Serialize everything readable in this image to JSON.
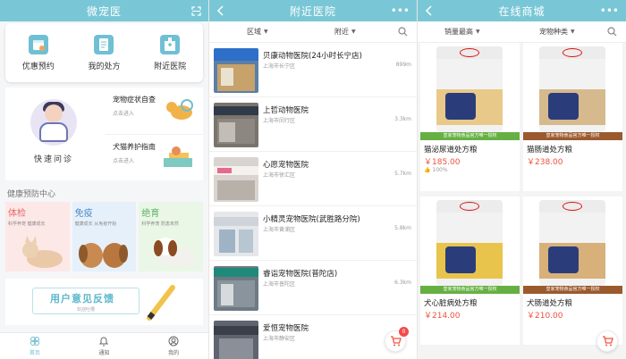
{
  "panel1": {
    "title": "微宠医",
    "quick": [
      {
        "icon": "calendar-icon",
        "label": "优惠预约"
      },
      {
        "icon": "prescription-icon",
        "label": "我的处方"
      },
      {
        "icon": "hospital-icon",
        "label": "附近医院"
      }
    ],
    "consult": {
      "label": "快速问诊",
      "items": [
        {
          "title": "宠物症状自查",
          "sub": "点击进入"
        },
        {
          "title": "犬猫养护指南",
          "sub": "点击进入"
        }
      ]
    },
    "section_title": "健康预防中心",
    "tiles": [
      {
        "title": "体检",
        "sub": "科学养宠   健康成长"
      },
      {
        "title": "免疫",
        "sub": "健康成长   从免疫开始"
      },
      {
        "title": "绝育",
        "sub": "科学养宠   防患未然"
      }
    ],
    "banner": {
      "text": "用户意见反馈",
      "sub": "欢迎吐槽"
    },
    "tabs": [
      {
        "icon": "home-icon",
        "label": "首页",
        "active": true
      },
      {
        "icon": "bell-icon",
        "label": "通知",
        "active": false
      },
      {
        "icon": "user-icon",
        "label": "我的",
        "active": false
      }
    ]
  },
  "panel2": {
    "title": "附近医院",
    "filters": [
      "区域",
      "附近"
    ],
    "clinics": [
      {
        "name": "贝康动物医院(24小时长宁店)",
        "addr": "上海市长宁区",
        "dist": "899m"
      },
      {
        "name": "上哲动物医院",
        "addr": "上海市闵行区",
        "dist": "3.3km"
      },
      {
        "name": "心愿宠物医院",
        "addr": "上海市徐汇区",
        "dist": "5.7km"
      },
      {
        "name": "小精灵宠物医院(武胜路分院)",
        "addr": "上海市黄浦区",
        "dist": "5.8km"
      },
      {
        "name": "睿诣宠物医院(普陀店)",
        "addr": "上海市普陀区",
        "dist": "6.3km"
      },
      {
        "name": "爱恒宠物医院",
        "addr": "上海市静安区",
        "dist": ""
      }
    ],
    "cart_count": "0"
  },
  "panel3": {
    "title": "在线商城",
    "filters": [
      "销量最高",
      "宠物种类"
    ],
    "products": [
      {
        "name": "猫泌尿道处方粮",
        "price": "￥185.00",
        "rating": "100%",
        "ribbon": "皇家宠物食品官方唯一授权",
        "ribbon_color": "#66b043",
        "stripe": "#e9c98a"
      },
      {
        "name": "猫肠道处方粮",
        "price": "￥238.00",
        "rating": "",
        "ribbon": "皇家宠物食品官方唯一授权",
        "ribbon_color": "#9b5a2e",
        "stripe": "#d7b98e"
      },
      {
        "name": "犬心脏病处方粮",
        "price": "￥214.00",
        "rating": "",
        "ribbon": "皇家宠物食品官方唯一授权",
        "ribbon_color": "#66b043",
        "stripe": "#e8c44d"
      },
      {
        "name": "犬肠道处方粮",
        "price": "￥210.00",
        "rating": "",
        "ribbon": "皇家宠物食品官方唯一授权",
        "ribbon_color": "#9b5a2e",
        "stripe": "#d8b07a"
      }
    ]
  }
}
